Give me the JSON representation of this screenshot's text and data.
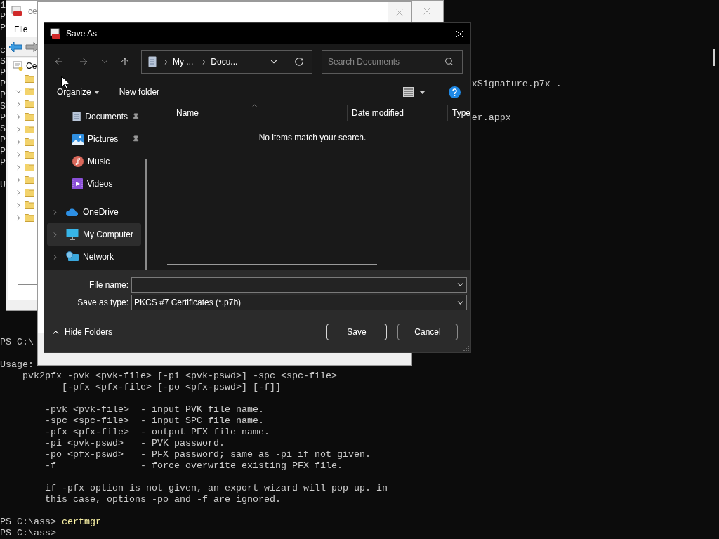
{
  "console": {
    "top_lines": [
      {
        "kind": "text",
        "text": "1"
      },
      {
        "kind": "text",
        "text": "P"
      },
      {
        "kind": "text",
        "text": "P"
      },
      {
        "kind": "blank"
      },
      {
        "kind": "text",
        "text": "c"
      },
      {
        "kind": "text",
        "text": "S"
      },
      {
        "kind": "text",
        "text": "P"
      },
      {
        "kind": "text",
        "text": "P",
        "tail": "xSignature.p7x ."
      },
      {
        "kind": "text",
        "text": "P"
      },
      {
        "kind": "text",
        "text": "S"
      },
      {
        "kind": "text",
        "text": "P",
        "tail": "er.appx"
      },
      {
        "kind": "text",
        "text": "S"
      },
      {
        "kind": "text",
        "text": "P"
      },
      {
        "kind": "text",
        "text": "P"
      },
      {
        "kind": "text",
        "text": "P"
      },
      {
        "kind": "blank"
      },
      {
        "kind": "text",
        "text": "U"
      }
    ],
    "bottom_lines": [
      {
        "kind": "text",
        "text": "PS C:\\"
      },
      {
        "kind": "blank"
      },
      {
        "kind": "text",
        "text": "Usage:"
      },
      {
        "kind": "text",
        "text": "    pvk2pfx -pvk <pvk-file> [-pi <pvk-pswd>] -spc <spc-file>"
      },
      {
        "kind": "text",
        "text": "           [-pfx <pfx-file> [-po <pfx-pswd>] [-f]]"
      },
      {
        "kind": "blank"
      },
      {
        "kind": "text",
        "text": "        -pvk <pvk-file>  - input PVK file name."
      },
      {
        "kind": "text",
        "text": "        -spc <spc-file>  - input SPC file name."
      },
      {
        "kind": "text",
        "text": "        -pfx <pfx-file>  - output PFX file name."
      },
      {
        "kind": "text",
        "text": "        -pi <pvk-pswd>   - PVK password."
      },
      {
        "kind": "text",
        "text": "        -po <pfx-pswd>   - PFX password; same as -pi if not given."
      },
      {
        "kind": "text",
        "text": "        -f               - force overwrite existing PFX file."
      },
      {
        "kind": "blank"
      },
      {
        "kind": "text",
        "text": "        if -pfx option is not given, an export wizard will pop up. in"
      },
      {
        "kind": "text",
        "text": "        this case, options -po and -f are ignored."
      },
      {
        "kind": "blank"
      },
      {
        "kind": "prompt",
        "text": "PS C:\\ass>",
        "command": "certmgr"
      },
      {
        "kind": "prompt",
        "text": "PS C:\\ass>"
      }
    ]
  },
  "certmgr_window": {
    "title": "ce",
    "menu": [
      "File"
    ],
    "tree": {
      "label": "Ce",
      "children": [
        {
          "kind": "leaf"
        },
        {
          "kind": "branch",
          "expanded": true
        },
        {
          "kind": "branch",
          "expanded": false
        },
        {
          "kind": "branch",
          "expanded": false
        },
        {
          "kind": "branch",
          "expanded": false
        },
        {
          "kind": "branch",
          "expanded": false
        },
        {
          "kind": "branch",
          "expanded": false
        },
        {
          "kind": "branch",
          "expanded": false
        },
        {
          "kind": "branch",
          "expanded": false
        },
        {
          "kind": "branch",
          "expanded": false
        },
        {
          "kind": "branch",
          "expanded": false
        },
        {
          "kind": "branch",
          "expanded": false
        }
      ]
    }
  },
  "save_as_dialog": {
    "title": "Save As",
    "breadcrumbs": [
      "My ...",
      "Docu..."
    ],
    "search": {
      "placeholder": "Search Documents"
    },
    "commands": {
      "organize": "Organize",
      "new_folder": "New folder"
    },
    "sidebar": {
      "items": [
        {
          "kind": "pinned",
          "label": "Documents",
          "selected": false
        },
        {
          "kind": "pinned",
          "label": "Pictures",
          "selected": false
        },
        {
          "kind": "folder",
          "label": "Music",
          "selected": false
        },
        {
          "kind": "folder",
          "label": "Videos",
          "selected": false
        },
        {
          "kind": "location",
          "label": "OneDrive",
          "selected": false
        },
        {
          "kind": "location",
          "label": "My Computer",
          "selected": true
        },
        {
          "kind": "location",
          "label": "Network",
          "selected": false
        }
      ]
    },
    "columns": [
      {
        "label": "Name",
        "sorted": true
      },
      {
        "label": "Date modified",
        "sorted": false
      },
      {
        "label": "Type",
        "sorted": false
      }
    ],
    "empty_message": "No items match your search.",
    "file_name": {
      "label": "File name:"
    },
    "save_as_type": {
      "label": "Save as type:",
      "value": "PKCS #7 Certificates (*.p7b)"
    },
    "hide_folders": "Hide Folders",
    "buttons": [
      {
        "label": "Save",
        "default": true
      },
      {
        "label": "Cancel",
        "default": false
      }
    ]
  }
}
